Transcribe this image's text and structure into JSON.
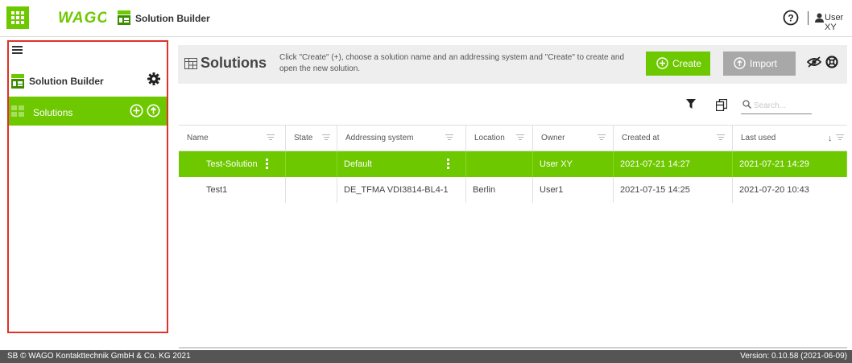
{
  "header": {
    "brand": "WAGO",
    "app_title": "Solution Builder",
    "user_name": "User XY",
    "icons": [
      "app-grid-icon",
      "wago-logo",
      "solution-builder-icon",
      "help-icon",
      "user-icon"
    ]
  },
  "sidebar": {
    "section_title": "Solution Builder",
    "items": [
      {
        "label": "Solutions",
        "active": true
      }
    ],
    "icons": [
      "hamburger-icon",
      "gear-icon",
      "add-circle-icon",
      "import-circle-icon"
    ]
  },
  "main": {
    "title": "Solutions",
    "hint": "Click \"Create\" (+), choose a solution name and an addressing system and \"Create\" to create and open the new solution.",
    "create_label": "Create",
    "import_label": "Import",
    "search_placeholder": "Search..."
  },
  "table": {
    "columns": [
      "Name",
      "State",
      "Addressing system",
      "Location",
      "Owner",
      "Created at",
      "Last used"
    ],
    "sorted_column": "Last used",
    "sort_direction": "descending",
    "rows": [
      {
        "name": "Test-Solution",
        "state": "",
        "addressing": "Default",
        "location": "",
        "owner": "User XY",
        "created": "2021-07-21 14:27",
        "last_used": "2021-07-21 14:29",
        "selected": true
      },
      {
        "name": "Test1",
        "state": "",
        "addressing": "DE_TFMA VDI3814-BL4-1",
        "location": "Berlin",
        "owner": "User1",
        "created": "2021-07-15 14:25",
        "last_used": "2021-07-20 10:43",
        "selected": false
      }
    ]
  },
  "footer": {
    "copyright": "SB © WAGO Kontakttechnik GmbH & Co. KG 2021",
    "version": "Version: 0.10.58 (2021-06-09)"
  },
  "colors": {
    "accent": "#6ec800",
    "header_bg": "#eeeeee",
    "import_button": "#a8a8a8",
    "footer_bg": "#555555",
    "highlight_border": "#e0312a"
  }
}
